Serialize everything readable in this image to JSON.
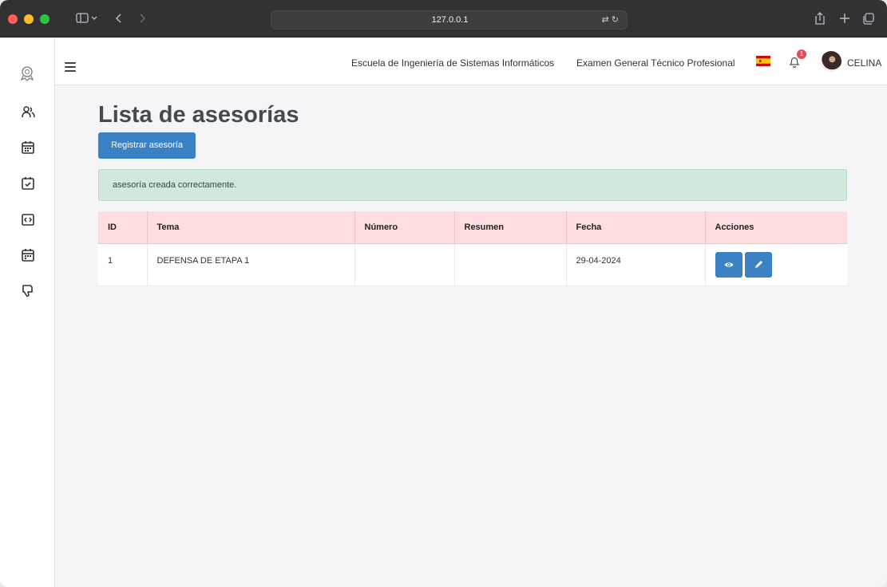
{
  "browser": {
    "url": "127.0.0.1"
  },
  "header": {
    "links": [
      "Escuela de Ingeniería de Sistemas Informáticos",
      "Examen General Técnico Profesional"
    ],
    "notification_count": "1",
    "user_name": "CELINA"
  },
  "sidebar": {
    "items": [
      "users-icon",
      "calendar-icon",
      "calendar-check-icon",
      "code-window-icon",
      "calendar-icon",
      "thumbs-down-icon"
    ]
  },
  "main": {
    "title": "Lista de asesorías",
    "register_button": "Registrar asesoría",
    "alert_message": "asesoría creada correctamente.",
    "table": {
      "columns": [
        "ID",
        "Tema",
        "Número",
        "Resumen",
        "Fecha",
        "Acciones"
      ],
      "rows": [
        {
          "id": "1",
          "tema": "DEFENSA DE ETAPA 1",
          "numero": "",
          "resumen": "",
          "fecha": "29-04-2024"
        }
      ]
    }
  },
  "colors": {
    "primary": "#3b82c4",
    "table_header": "#fddde0",
    "alert_bg": "#d3e8dc"
  }
}
